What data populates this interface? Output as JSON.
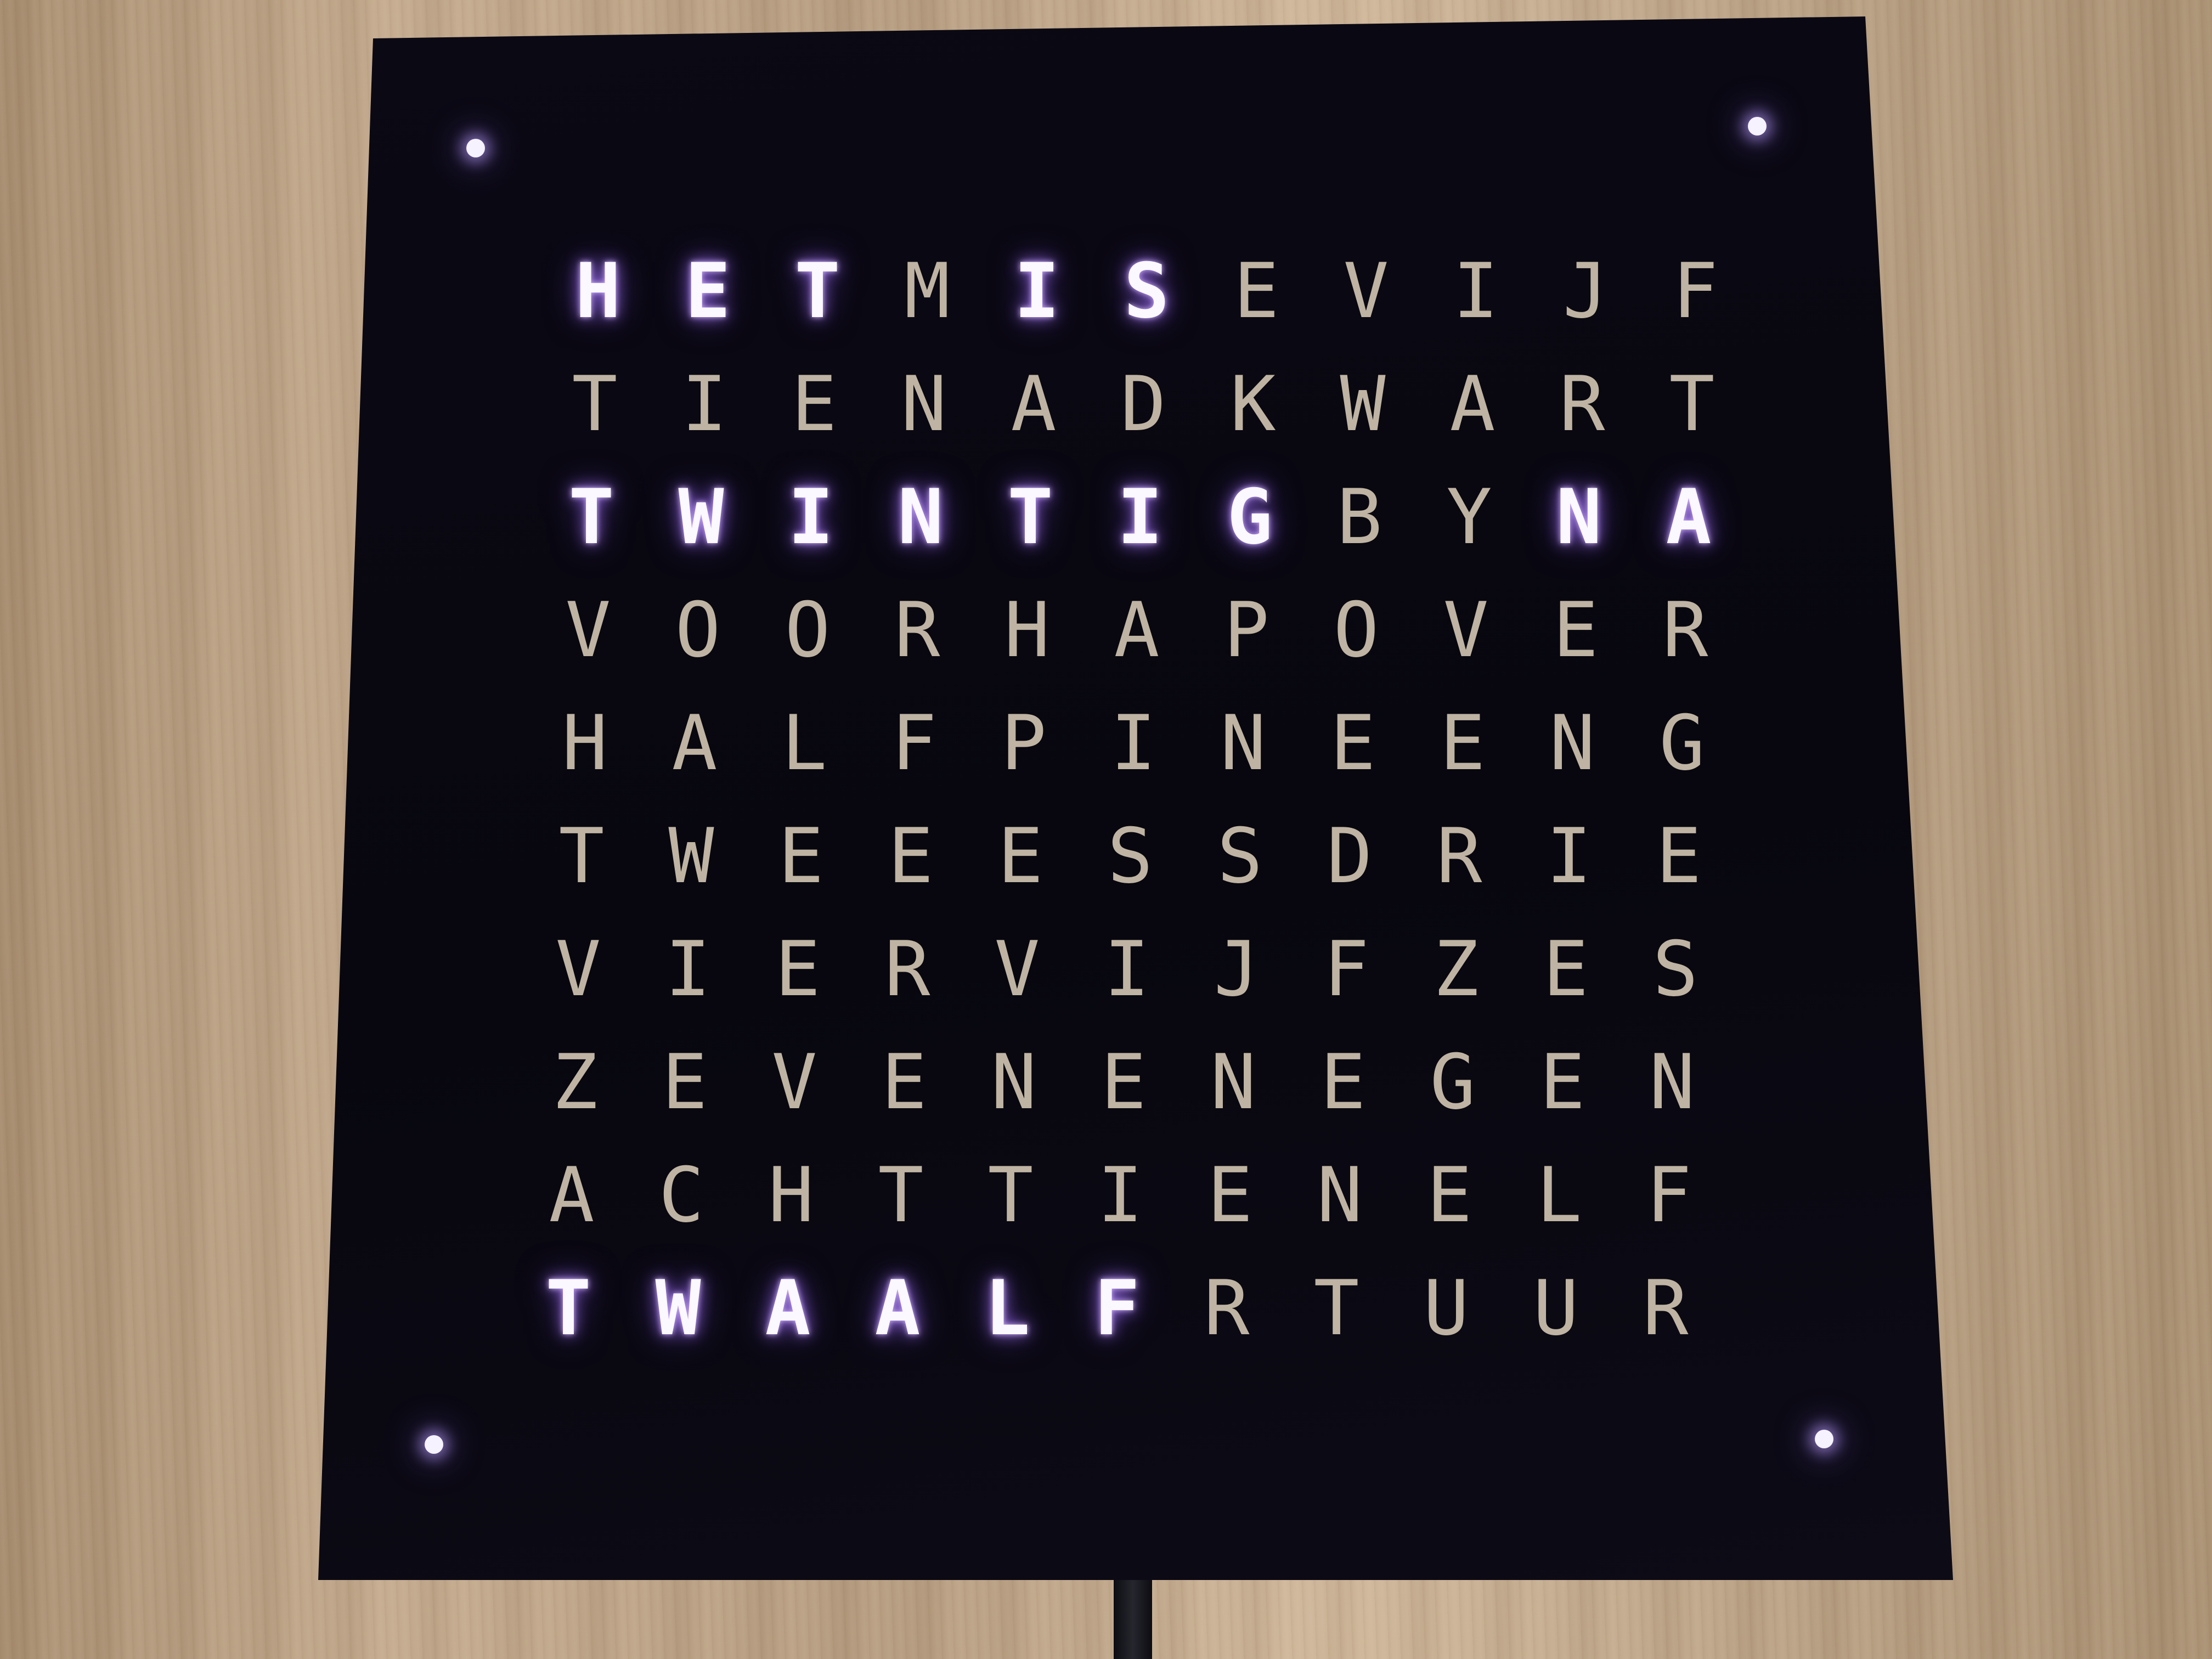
{
  "clock": {
    "grid": [
      "HETMISEVIJF",
      "TIENADKWART",
      "TWINTIGBYNA",
      "VOORHAPOVER",
      "HALFPINEENG",
      "TWEEESSDRIE",
      "VIERVIJFZES",
      "ZEVENENEGEN",
      "ACHTTIENELF",
      "TWAALFRTUUR"
    ],
    "lit": [
      [
        0,
        0
      ],
      [
        0,
        1
      ],
      [
        0,
        2
      ],
      [
        0,
        4
      ],
      [
        0,
        5
      ],
      [
        2,
        0
      ],
      [
        2,
        1
      ],
      [
        2,
        2
      ],
      [
        2,
        3
      ],
      [
        2,
        4
      ],
      [
        2,
        5
      ],
      [
        2,
        6
      ],
      [
        2,
        9
      ],
      [
        2,
        10
      ],
      [
        9,
        0
      ],
      [
        9,
        1
      ],
      [
        9,
        2
      ],
      [
        9,
        3
      ],
      [
        9,
        4
      ],
      [
        9,
        5
      ]
    ],
    "colors": {
      "lit": "#fbf8ff",
      "glow": "#a878ff",
      "unlit": "#bfb4a3",
      "panel": "#0a0812"
    }
  }
}
